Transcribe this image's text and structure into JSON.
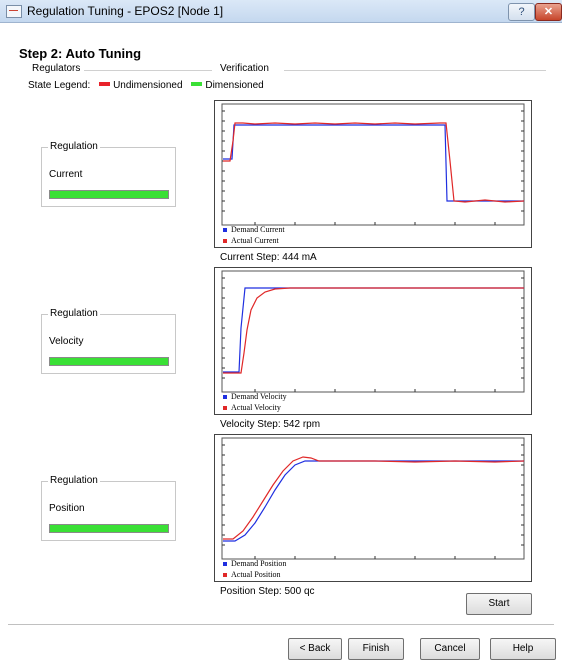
{
  "window": {
    "title": "Regulation Tuning - EPOS2 [Node 1]",
    "help_label": "?",
    "close_label": "✕"
  },
  "step_title": "Step 2: Auto Tuning",
  "sections": {
    "regulators": "Regulators",
    "verification": "Verification"
  },
  "legend": {
    "label": "State Legend:",
    "items": [
      {
        "label": "Undimensioned",
        "color": "#e8232b"
      },
      {
        "label": "Dimensioned",
        "color": "#3ae035"
      }
    ]
  },
  "groups": [
    {
      "title": "Regulation",
      "name": "Current",
      "progress": 1.0
    },
    {
      "title": "Regulation",
      "name": "Velocity",
      "progress": 1.0
    },
    {
      "title": "Regulation",
      "name": "Position",
      "progress": 1.0
    }
  ],
  "charts": [
    {
      "legend": [
        "Demand Current",
        "Actual Current"
      ],
      "step_label": "Current Step: 444 mA"
    },
    {
      "legend": [
        "Demand Velocity",
        "Actual Velocity"
      ],
      "step_label": "Velocity Step: 542 rpm"
    },
    {
      "legend": [
        "Demand Position",
        "Actual Position"
      ],
      "step_label": "Position Step: 500 qc"
    }
  ],
  "series_colors": {
    "demand": "#1f2fe0",
    "actual": "#e02828"
  },
  "buttons": {
    "start": "Start",
    "back": "< Back",
    "finish": "Finish",
    "cancel": "Cancel",
    "help": "Help"
  }
}
